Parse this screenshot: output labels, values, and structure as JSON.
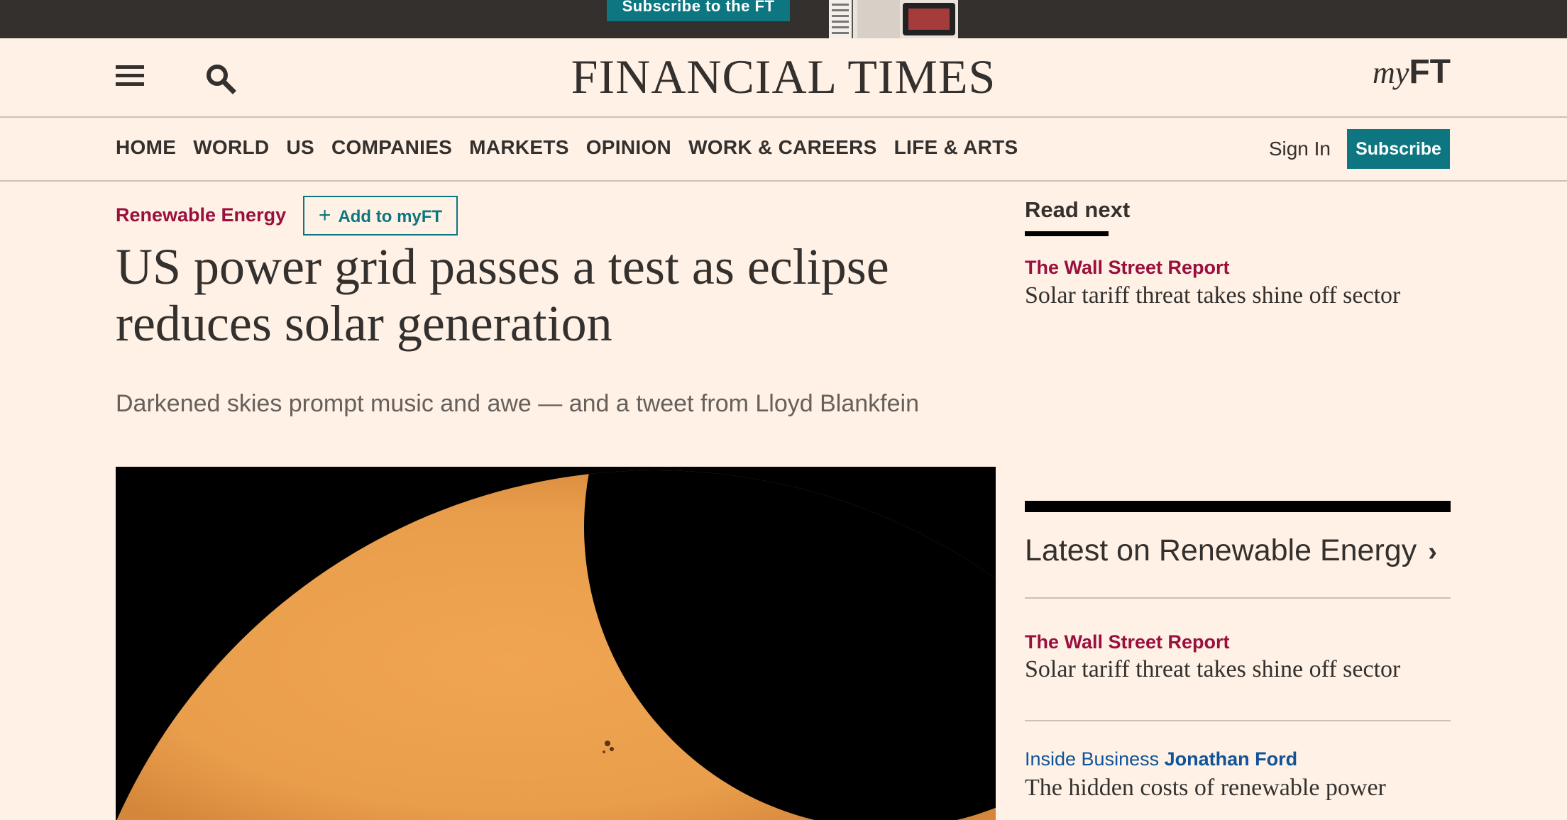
{
  "promo": {
    "subscribe_label": "Subscribe to the FT"
  },
  "header": {
    "logo": "FINANCIAL TIMES",
    "myft_prefix": "my",
    "myft_suffix": "FT"
  },
  "nav": {
    "items": [
      "HOME",
      "WORLD",
      "US",
      "COMPANIES",
      "MARKETS",
      "OPINION",
      "WORK & CAREERS",
      "LIFE & ARTS"
    ],
    "sign_in": "Sign In",
    "subscribe": "Subscribe"
  },
  "article": {
    "topic": "Renewable Energy",
    "add_myft": "Add to myFT",
    "headline": "US power grid passes a test as eclipse reduces solar generation",
    "standfirst": "Darkened skies prompt music and awe — and a tweet from Lloyd Blankfein"
  },
  "rail": {
    "read_next_label": "Read next",
    "read_next": {
      "tag": "The Wall Street Report",
      "title": "Solar tariff threat takes shine off sector"
    },
    "latest_label": "Latest on Renewable Energy",
    "latest_items": [
      {
        "tag": "The Wall Street Report",
        "title": "Solar tariff threat takes shine off sector"
      },
      {
        "tag_prefix": "Inside Business",
        "author": "Jonathan Ford",
        "title": "The hidden costs of renewable power"
      }
    ]
  },
  "colors": {
    "background": "#fff1e5",
    "teal": "#0d7680",
    "claret": "#990f3d",
    "oxford": "#0f5499"
  }
}
